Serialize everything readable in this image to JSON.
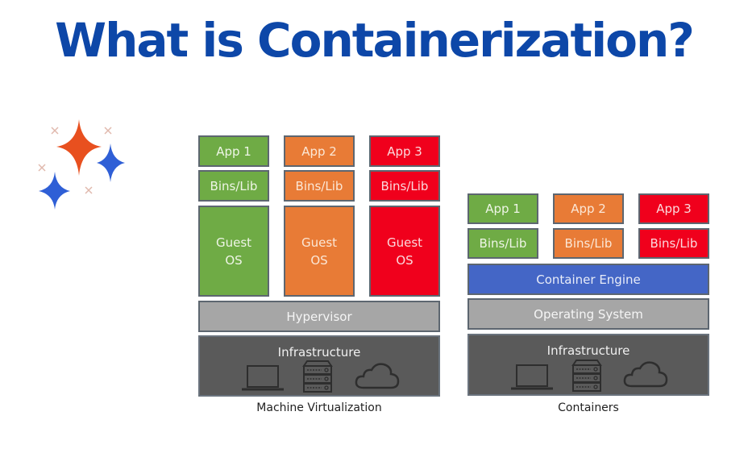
{
  "title": "What is Containerization?",
  "colors": {
    "title": "#0d47a8",
    "app1": "#6fab45",
    "app2": "#e87b36",
    "app3": "#f0001c",
    "hypervisor": "#a6a6a6",
    "container_engine": "#4466c6",
    "infrastructure": "#5a5a5a"
  },
  "decor": {
    "icon": "sparkles-icon"
  },
  "machine_virtualization": {
    "caption": "Machine Virtualization",
    "stacks": [
      {
        "app": "App 1",
        "bins": "Bins/Lib",
        "os_line1": "Guest",
        "os_line2": "OS"
      },
      {
        "app": "App 2",
        "bins": "Bins/Lib",
        "os_line1": "Guest",
        "os_line2": "OS"
      },
      {
        "app": "App 3",
        "bins": "Bins/Lib",
        "os_line1": "Guest",
        "os_line2": "OS"
      }
    ],
    "hypervisor": "Hypervisor",
    "infrastructure": "Infrastructure",
    "infra_icons": [
      "laptop-icon",
      "server-icon",
      "cloud-icon"
    ]
  },
  "containers": {
    "caption": "Containers",
    "stacks": [
      {
        "app": "App 1",
        "bins": "Bins/Lib"
      },
      {
        "app": "App 2",
        "bins": "Bins/Lib"
      },
      {
        "app": "App 3",
        "bins": "Bins/Lib"
      }
    ],
    "container_engine": "Container Engine",
    "operating_system": "Operating System",
    "infrastructure": "Infrastructure",
    "infra_icons": [
      "laptop-icon",
      "server-icon",
      "cloud-icon"
    ]
  }
}
